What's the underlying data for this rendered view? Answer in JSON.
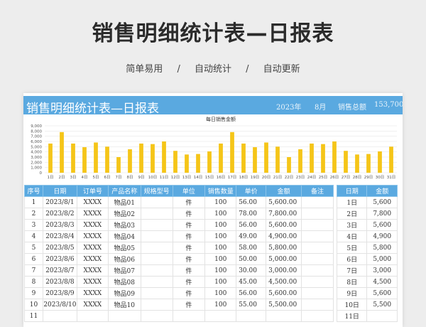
{
  "page": {
    "title": "销售明细统计表—日报表",
    "tags": [
      "简单易用",
      "自动统计",
      "自动更新"
    ],
    "separator": "/"
  },
  "sheet": {
    "title": "销售明细统计表—日报表",
    "year": "2023年",
    "month": "8月",
    "total_label": "销售总额",
    "total_value": "153,700"
  },
  "chart_data": {
    "type": "bar",
    "title": "每日销售金额",
    "categories": [
      "1日",
      "2日",
      "3日",
      "4日",
      "5日",
      "6日",
      "7日",
      "8日",
      "9日",
      "10日",
      "11日",
      "12日",
      "13日",
      "14日",
      "15日",
      "16日",
      "17日",
      "18日",
      "19日",
      "20日",
      "21日",
      "22日",
      "23日",
      "24日",
      "25日",
      "26日",
      "27日",
      "28日",
      "29日",
      "30日",
      "31日"
    ],
    "values": [
      5600,
      7800,
      5600,
      4900,
      5800,
      5000,
      3000,
      4500,
      5600,
      5500,
      6000,
      4200,
      3500,
      3600,
      4100,
      5600,
      7800,
      5600,
      4900,
      5800,
      5000,
      3000,
      4500,
      5600,
      5500,
      6000,
      4200,
      3500,
      3600,
      4100,
      5000
    ],
    "yticks": [
      "0",
      "1,000",
      "2,000",
      "3,000",
      "4,000",
      "5,000",
      "6,000",
      "7,000",
      "8,000",
      "9,000"
    ],
    "ylim": [
      0,
      9000
    ],
    "bar_color": "#f5c518"
  },
  "table": {
    "headers": [
      "序号",
      "日期",
      "订单号",
      "产品名称",
      "规格型号",
      "单位",
      "销售数量",
      "单价",
      "金额",
      "备注"
    ],
    "rows": [
      [
        "1",
        "2023/8/1",
        "XXXX",
        "物品01",
        "",
        "件",
        "100",
        "56.00",
        "5,600.00",
        ""
      ],
      [
        "2",
        "2023/8/2",
        "XXXX",
        "物品02",
        "",
        "件",
        "100",
        "78.00",
        "7,800.00",
        ""
      ],
      [
        "3",
        "2023/8/3",
        "XXXX",
        "物品03",
        "",
        "件",
        "100",
        "56.00",
        "5,600.00",
        ""
      ],
      [
        "4",
        "2023/8/4",
        "XXXX",
        "物品04",
        "",
        "件",
        "100",
        "49.00",
        "4,900.00",
        ""
      ],
      [
        "5",
        "2023/8/5",
        "XXXX",
        "物品05",
        "",
        "件",
        "100",
        "58.00",
        "5,800.00",
        ""
      ],
      [
        "6",
        "2023/8/6",
        "XXXX",
        "物品06",
        "",
        "件",
        "100",
        "50.00",
        "5,000.00",
        ""
      ],
      [
        "7",
        "2023/8/7",
        "XXXX",
        "物品07",
        "",
        "件",
        "100",
        "30.00",
        "3,000.00",
        ""
      ],
      [
        "8",
        "2023/8/8",
        "XXXX",
        "物品08",
        "",
        "件",
        "100",
        "45.00",
        "4,500.00",
        ""
      ],
      [
        "9",
        "2023/8/9",
        "XXXX",
        "物品09",
        "",
        "件",
        "100",
        "56.00",
        "5,600.00",
        ""
      ],
      [
        "10",
        "2023/8/10",
        "XXXX",
        "物品10",
        "",
        "件",
        "100",
        "55.00",
        "5,500.00",
        ""
      ],
      [
        "11",
        "",
        "",
        "",
        "",
        "",
        "",
        "",
        "",
        ""
      ]
    ]
  },
  "summary": {
    "headers": [
      "日期",
      "金额"
    ],
    "rows": [
      [
        "1日",
        "5,600"
      ],
      [
        "2日",
        "7,800"
      ],
      [
        "3日",
        "5,600"
      ],
      [
        "4日",
        "4,900"
      ],
      [
        "5日",
        "5,800"
      ],
      [
        "6日",
        "5,000"
      ],
      [
        "7日",
        "3,000"
      ],
      [
        "8日",
        "4,500"
      ],
      [
        "9日",
        "5,600"
      ],
      [
        "10日",
        "5,500"
      ],
      [
        "11日",
        ""
      ]
    ]
  }
}
